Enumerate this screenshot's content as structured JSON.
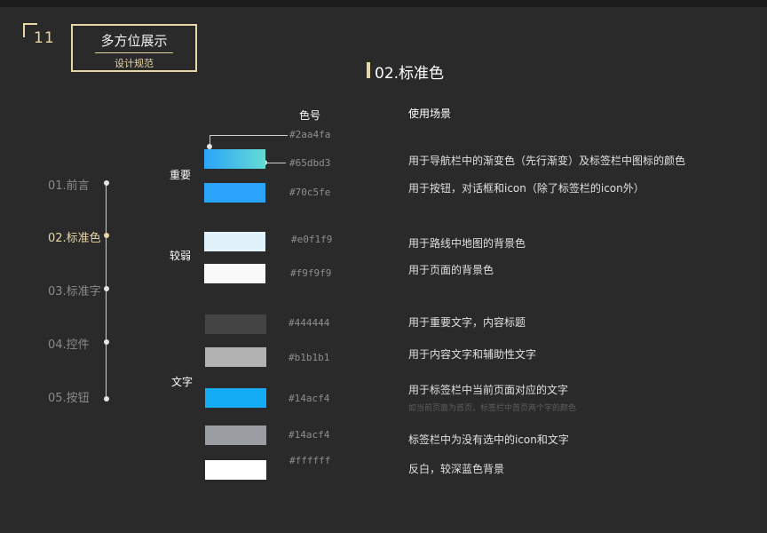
{
  "page_number": "11",
  "header": {
    "title": "多方位展示",
    "subtitle": "设计规范"
  },
  "section": {
    "title": "02.标准色"
  },
  "nav": {
    "items": [
      {
        "label": "01.前言"
      },
      {
        "label": "02.标准色"
      },
      {
        "label": "03.标准字"
      },
      {
        "label": "04.控件"
      },
      {
        "label": "05.按钮"
      }
    ]
  },
  "columns": {
    "color": "色号",
    "usage": "使用场景"
  },
  "groups": {
    "important": "重要",
    "weak": "较弱",
    "text": "文字"
  },
  "colors": [
    {
      "hex": "#2aa4fa",
      "usage": "用于导航栏中的渐变色（先行渐变）及标签栏中图标的颜色"
    },
    {
      "hex": "#65dbd3"
    },
    {
      "hex": "#70c5fe",
      "usage": "用于按钮，对话框和icon（除了标签栏的icon外）"
    },
    {
      "hex": "#e0f1f9",
      "usage": "用于路线中地图的背景色"
    },
    {
      "hex": "#f9f9f9",
      "usage": "用于页面的背景色"
    },
    {
      "hex": "#444444",
      "usage": "用于重要文字，内容标题"
    },
    {
      "hex": "#b1b1b1",
      "usage": "用于内容文字和辅助性文字"
    },
    {
      "hex": "#14acf4",
      "usage": "用于标签栏中当前页面对应的文字",
      "note": "如当前页面为首页，标签栏中首页两个字的颜色"
    },
    {
      "hex": "#14acf4",
      "usage": "标签栏中为没有选中的icon和文字"
    },
    {
      "hex": "#ffffff",
      "usage": "反白，较深蓝色背景"
    }
  ],
  "swatch_fills": {
    "gradient_start": "#2aa4fa",
    "gradient_end": "#65dbd3",
    "button_blue": "#2aa4fa",
    "map_bg": "#e0f1f9",
    "page_bg": "#f9f9f9",
    "dark_text": "#444444",
    "gray_text": "#b1b1b1",
    "active_tab": "#14acf4",
    "inactive_tab": "#9a9ea3",
    "white": "#ffffff"
  },
  "theme": {
    "accent": "#e8d7a6",
    "background": "#2a2a2a"
  }
}
